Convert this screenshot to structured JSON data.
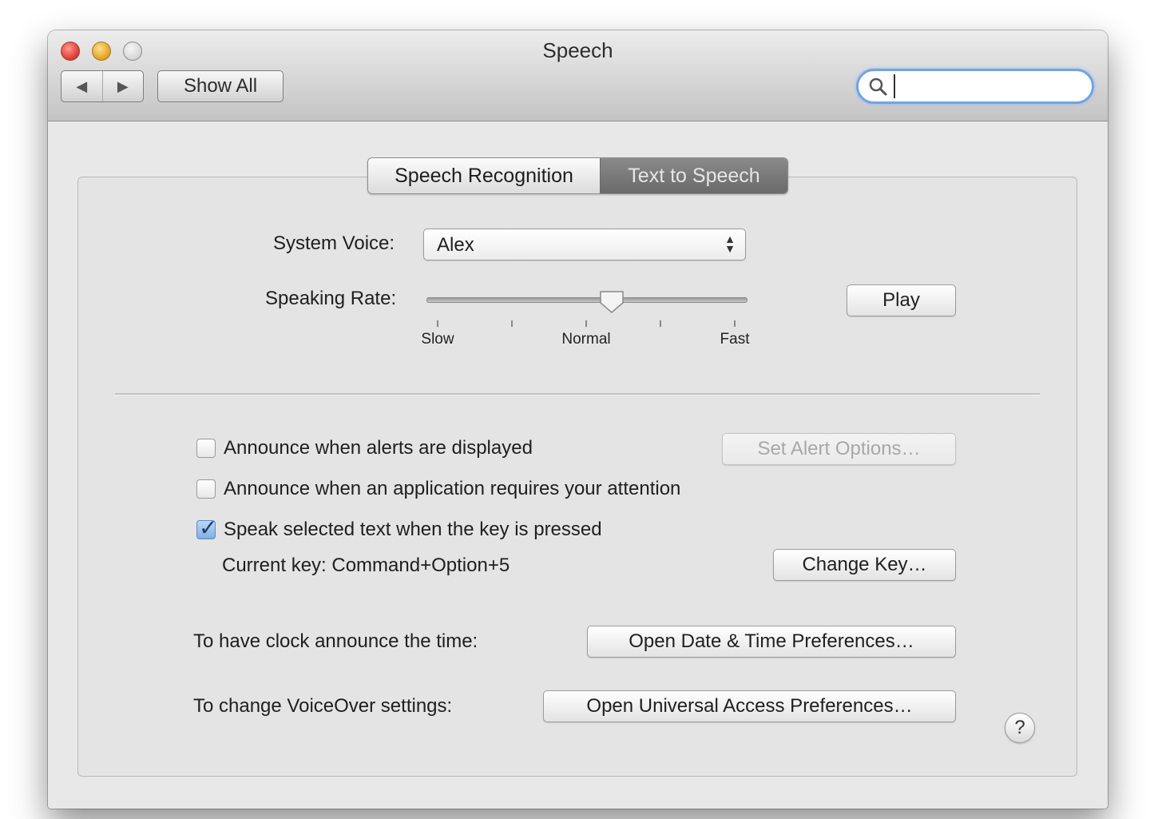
{
  "window": {
    "title": "Speech"
  },
  "toolbar": {
    "back_icon": "◀",
    "forward_icon": "▶",
    "show_all_label": "Show All",
    "search": {
      "value": "",
      "placeholder": ""
    }
  },
  "tabs": [
    {
      "label": "Speech Recognition",
      "selected": false
    },
    {
      "label": "Text to Speech",
      "selected": true
    }
  ],
  "voice": {
    "label": "System Voice:",
    "selected": "Alex"
  },
  "rate": {
    "label": "Speaking Rate:",
    "level_fraction": 0.58,
    "ticks": [
      "Slow",
      "",
      "Normal",
      "",
      "Fast"
    ]
  },
  "play_label": "Play",
  "options": {
    "announce_alerts": {
      "label": "Announce when alerts are displayed",
      "checked": false
    },
    "alert_options_label": "Set Alert Options…",
    "announce_attention": {
      "label": "Announce when an application requires your attention",
      "checked": false
    },
    "speak_selected": {
      "label": "Speak selected text when the key is pressed",
      "checked": true
    },
    "current_key": "Current key: Command+Option+5",
    "change_key_label": "Change Key…"
  },
  "clock": {
    "label": "To have clock announce the time:",
    "button_label": "Open Date & Time Preferences…"
  },
  "voiceover": {
    "label": "To change VoiceOver settings:",
    "button_label": "Open Universal Access Preferences…"
  },
  "help_label": "?",
  "colors": {
    "accent": "#6ea4e8",
    "selected_tab": "#7a7a7a"
  }
}
